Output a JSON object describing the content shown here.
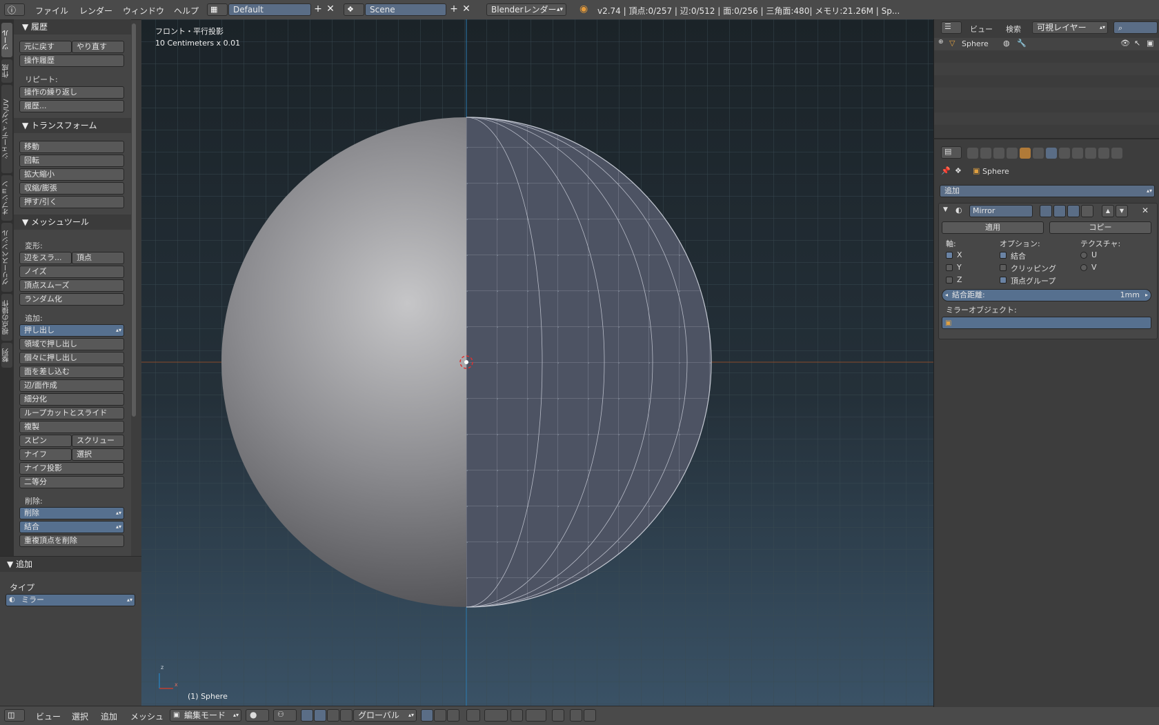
{
  "topbar": {
    "menu": [
      "ファイル",
      "レンダー",
      "ウィンドウ",
      "ヘルプ"
    ],
    "screen_layout": "Default",
    "scene": "Scene",
    "render_engine": "Blenderレンダー",
    "stats": "v2.74 | 頂点:0/257 | 辺:0/512 | 面:0/256 | 三角面:480| メモリ:21.26M | Sp..."
  },
  "tabs": [
    "ツール",
    "作成",
    "シェーディング/UV",
    "オプション",
    "グリースペンシル",
    "視点の操作",
    "整列"
  ],
  "toolshelf": {
    "history_header": "▼ 履歴",
    "undo": "元に戻す",
    "redo": "やり直す",
    "op_history": "操作履歴",
    "repeat_label": "リピート:",
    "repeat_last": "操作の繰り返し",
    "history_menu": "履歴...",
    "transform_header": "▼ トランスフォーム",
    "translate": "移動",
    "rotate": "回転",
    "scale": "拡大縮小",
    "shrink_fatten": "収縮/膨張",
    "push_pull": "押す/引く",
    "mesh_tools_header": "▼ メッシュツール",
    "deform_label": "変形:",
    "slide_edge": "辺をスラ...",
    "slide_vertex": "頂点",
    "noise": "ノイズ",
    "smooth_vertex": "頂点スムーズ",
    "randomize": "ランダム化",
    "add_label": "追加:",
    "extrude": "押し出し",
    "extrude_region": "領域で押し出し",
    "extrude_individual": "個々に押し出し",
    "inset_faces": "面を差し込む",
    "edge_face": "辺/面作成",
    "subdivide": "細分化",
    "loopcut": "ループカットとスライド",
    "duplicate": "複製",
    "spin": "スピン",
    "screw": "スクリュー",
    "knife": "ナイフ",
    "knife_select": "選択",
    "knife_project": "ナイフ投影",
    "bisect": "二等分",
    "remove_label": "削除:",
    "delete": "削除",
    "merge": "結合",
    "remove_doubles": "重複頂点を削除"
  },
  "operator_panel": {
    "header": "▼ 追加",
    "type_label": "タイプ",
    "type_value": "ミラー"
  },
  "viewport": {
    "view_name": "フロント・平行投影",
    "scale_info": "10 Centimeters x 0.01",
    "object_label": "(1) Sphere",
    "axis_z": "z",
    "axis_x": "x"
  },
  "bottombar": {
    "menu": [
      "ビュー",
      "選択",
      "追加",
      "メッシュ"
    ],
    "mode": "編集モード",
    "orientation": "グローバル"
  },
  "outliner": {
    "view_menu": "ビュー",
    "search_menu": "検索",
    "filter": "可視レイヤー",
    "object_name": "Sphere"
  },
  "properties": {
    "breadcrumb_object": "Sphere",
    "add_modifier": "追加",
    "modifier_name": "Mirror",
    "apply_button": "適用",
    "copy_button": "コピー",
    "axis_label": "軸:",
    "options_label": "オプション:",
    "texture_label": "テクスチャ:",
    "axis_x": "X",
    "axis_y": "Y",
    "axis_z": "Z",
    "opt_merge": "結合",
    "opt_clipping": "クリッピング",
    "opt_vgroup": "頂点グループ",
    "tex_u": "U",
    "tex_v": "V",
    "merge_limit_label": "結合距離:",
    "merge_limit_value": "1mm",
    "mirror_object_label": "ミラーオブジェクト:",
    "axis_x_checked": true,
    "axis_y_checked": false,
    "axis_z_checked": false,
    "merge_checked": true,
    "clipping_checked": false,
    "vgroup_checked": true
  },
  "colors": {
    "accent_blue": "#56708f",
    "viewport_top": "#1b2328",
    "viewport_bottom": "#3a5266",
    "x_axis_line": "#8a4b2a",
    "z_axis_line": "#2b7ab0"
  }
}
